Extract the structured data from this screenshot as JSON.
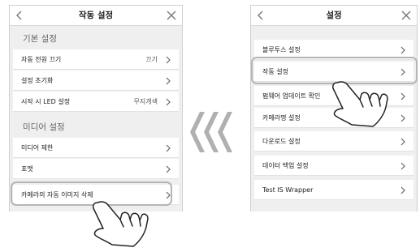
{
  "left_screen": {
    "title": "작동 설정",
    "icons": {
      "back": "chevron-left-icon",
      "close": "close-icon"
    },
    "sections": [
      {
        "header": "기본 설정"
      },
      {
        "header": "미디어 설정"
      }
    ],
    "rows": [
      {
        "label": "자동 전원 끄기",
        "value": "끄기"
      },
      {
        "label": "설정 초기화",
        "value": ""
      },
      {
        "label": "시작 시 LED 설정",
        "value": "무지개색"
      },
      {
        "label": "미디어 제한",
        "value": ""
      },
      {
        "label": "포맷",
        "value": ""
      },
      {
        "label": "카메라의 자동 이미지 삭제",
        "value": ""
      }
    ],
    "highlighted_row": "카메라의 자동 이미지 삭제"
  },
  "right_screen": {
    "title": "설정",
    "icons": {
      "back": "chevron-left-icon",
      "close": "close-icon"
    },
    "rows": [
      {
        "label": "블루투스 설정"
      },
      {
        "label": "작동 설정"
      },
      {
        "label": "펌웨어 업데이트 확인"
      },
      {
        "label": "카메라명 설정"
      },
      {
        "label": "다운로드 설정"
      },
      {
        "label": "데이터 백업 설정"
      },
      {
        "label": "Test IS Wrapper"
      }
    ],
    "highlighted_row": "작동 설정"
  },
  "colors": {
    "screen_bg": "#efefef",
    "row_bg": "#ffffff",
    "highlight_border": "#b5b5b5",
    "arrows": "#b0b0b0",
    "text": "#222222"
  },
  "decorations": [
    "triple-chevron-left-icon",
    "tap-hand-icon"
  ]
}
